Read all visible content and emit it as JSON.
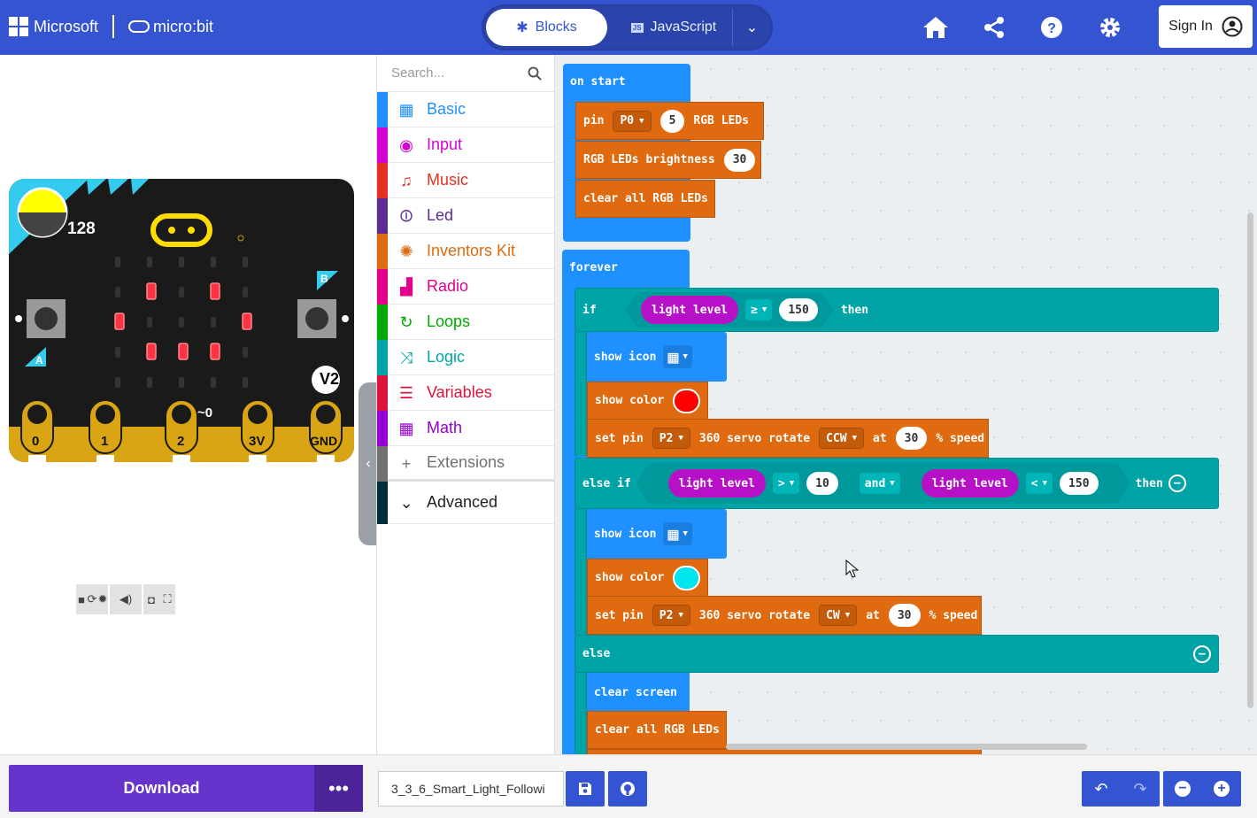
{
  "header": {
    "brand_microsoft": "Microsoft",
    "brand_microbit": "micro:bit",
    "tab_blocks": "Blocks",
    "tab_javascript": "JavaScript",
    "sign_in": "Sign In"
  },
  "simulator": {
    "light_value": "128",
    "version_badge": "V2",
    "button_a": "A",
    "button_b": "B",
    "pins": [
      "0",
      "1",
      "2",
      "3V",
      "GND"
    ],
    "pin_indicator": "~0"
  },
  "toolbox": {
    "search_placeholder": "Search...",
    "categories": [
      {
        "label": "Basic",
        "color": "#1e90ff"
      },
      {
        "label": "Input",
        "color": "#d400d4"
      },
      {
        "label": "Music",
        "color": "#e63022"
      },
      {
        "label": "Led",
        "color": "#5c2d91"
      },
      {
        "label": "Inventors Kit",
        "color": "#e06a0f"
      },
      {
        "label": "Radio",
        "color": "#e3008c"
      },
      {
        "label": "Loops",
        "color": "#00aa00"
      },
      {
        "label": "Logic",
        "color": "#00a4a6"
      },
      {
        "label": "Variables",
        "color": "#dc143c"
      },
      {
        "label": "Math",
        "color": "#9400d3"
      },
      {
        "label": "Extensions",
        "color": "#717171"
      },
      {
        "label": "Advanced",
        "color": "#002d3a"
      }
    ]
  },
  "workspace": {
    "on_start": "on start",
    "pin": "pin",
    "pin_value": "P0",
    "led_count": "5",
    "rgb_leds": "RGB LEDs",
    "brightness_label": "RGB LEDs brightness",
    "brightness_value": "30",
    "clear_all": "clear all RGB LEDs",
    "forever": "forever",
    "if": "if",
    "light_level": "light level",
    "op_ge": "≥",
    "val_150": "150",
    "then": "then",
    "show_icon": "show icon",
    "show_color": "show color",
    "set_pin": "set pin",
    "servo_pin": "P2",
    "servo_text": "360 servo rotate",
    "dir_ccw": "CCW",
    "dir_cw": "CW",
    "at": "at",
    "speed_value": "30",
    "pct_speed": "% speed",
    "else_if": "else if",
    "op_gt": ">",
    "val_10": "10",
    "and": "and",
    "op_lt": "<",
    "else": "else",
    "clear_screen": "clear screen",
    "color_red": "#ff0000",
    "color_cyan": "#00e5ee"
  },
  "bottom": {
    "download": "Download",
    "filename": "3_3_6_Smart_Light_Followi"
  }
}
